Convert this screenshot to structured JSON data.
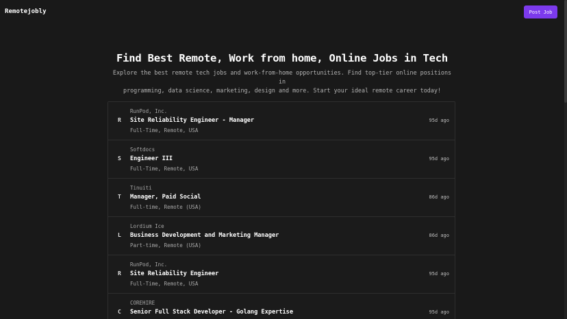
{
  "header": {
    "logo": "Remotejobly",
    "post_job_label": "Post Job"
  },
  "hero": {
    "title": "Find Best Remote, Work from home, Online Jobs in Tech",
    "subtitle_line1": "Explore the best remote tech jobs and work-from-home opportunities. Find top-tier online positions in",
    "subtitle_line2": "programming, data science, marketing, design and more. Start your ideal remote career today!"
  },
  "jobs": [
    {
      "letter": "R",
      "company": "RunPod, Inc.",
      "title": "Site Reliability Engineer - Manager",
      "meta": "Full-Time, Remote, USA",
      "age": "95d ago"
    },
    {
      "letter": "S",
      "company": "Softdocs",
      "title": "Engineer III",
      "meta": "Full-Time, Remote, USA",
      "age": "95d ago"
    },
    {
      "letter": "T",
      "company": "Tinuiti",
      "title": "Manager, Paid Social",
      "meta": "Full-time, Remote (USA)",
      "age": "86d ago"
    },
    {
      "letter": "L",
      "company": "Lordium Ice",
      "title": "Business Development and Marketing Manager",
      "meta": "Part-time, Remote (USA)",
      "age": "86d ago"
    },
    {
      "letter": "R",
      "company": "RunPod, Inc.",
      "title": "Site Reliability Engineer",
      "meta": "Full-Time, Remote, USA",
      "age": "95d ago"
    },
    {
      "letter": "C",
      "company": "COREHIRE",
      "title": "Senior Full Stack Developer - Golang Expertise",
      "meta": "",
      "age": "95d ago"
    }
  ],
  "colors": {
    "background": "#191919",
    "accent": "#7c3aed",
    "border": "#2f2f2f"
  }
}
